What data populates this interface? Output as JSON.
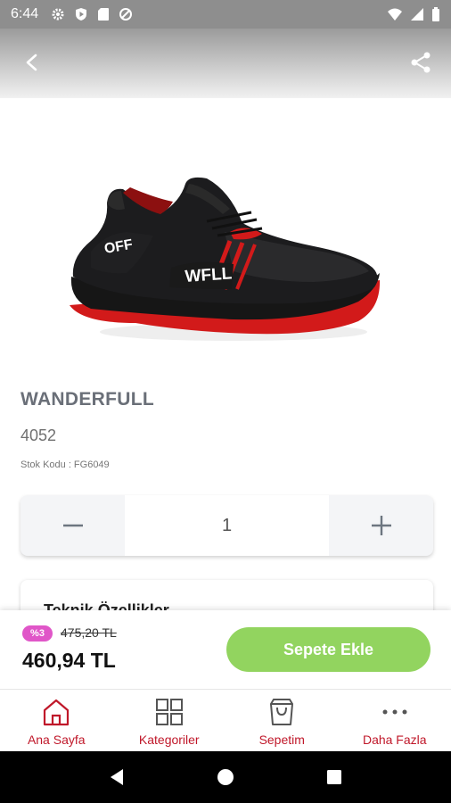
{
  "status_bar": {
    "time": "6:44"
  },
  "product": {
    "brand": "WANDERFULL",
    "name": "4052",
    "stock_code": "Stok Kodu : FG6049",
    "image_labels": {
      "off": "OFF",
      "wfll": "WFLL"
    }
  },
  "quantity": {
    "value": "1"
  },
  "info_card": {
    "label": "Teknik Özellikler"
  },
  "pricing": {
    "discount_badge": "%3",
    "old_price": "475,20 TL",
    "price": "460,94 TL",
    "add_to_cart_label": "Sepete Ekle"
  },
  "bottom_nav": {
    "items": [
      {
        "label": "Ana Sayfa",
        "icon": "home-icon"
      },
      {
        "label": "Kategoriler",
        "icon": "grid-icon"
      },
      {
        "label": "Sepetim",
        "icon": "cart-icon"
      },
      {
        "label": "Daha Fazla",
        "icon": "more-icon"
      }
    ]
  },
  "colors": {
    "accent_red": "#c0182a",
    "add_to_cart_green": "#92d45f",
    "discount_pink": "#e056c8"
  }
}
